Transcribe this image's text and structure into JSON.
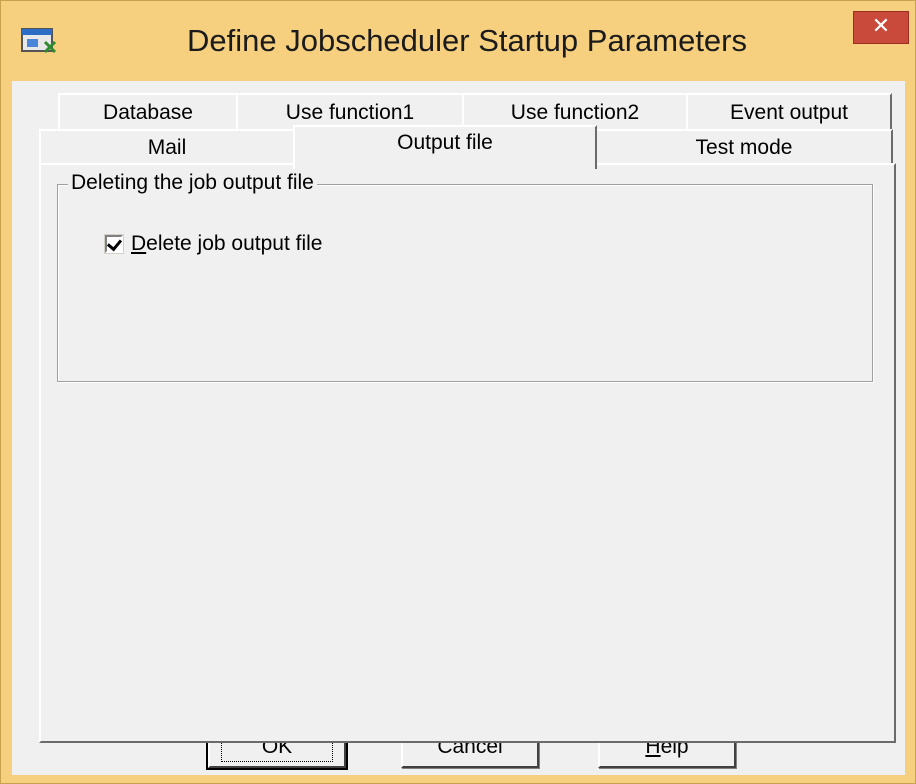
{
  "window": {
    "title": "Define Jobscheduler Startup Parameters",
    "close_icon": "close-icon",
    "app_icon": "app-window-icon"
  },
  "tabs": {
    "row1": [
      "Database",
      "Use function1",
      "Use function2",
      "Event output"
    ],
    "row2": [
      "Mail",
      "Output file",
      "Test mode"
    ],
    "active": "Output file"
  },
  "panel": {
    "group_title": "Deleting the job output file",
    "checkbox": {
      "mnemonic": "D",
      "rest": "elete job output file",
      "checked": true
    }
  },
  "buttons": {
    "ok": "OK",
    "cancel": "Cancel",
    "help_mnemonic": "H",
    "help_rest": "elp"
  },
  "colors": {
    "titlebar": "#f7d07f",
    "close": "#c9493a",
    "face": "#f0f0f0"
  }
}
